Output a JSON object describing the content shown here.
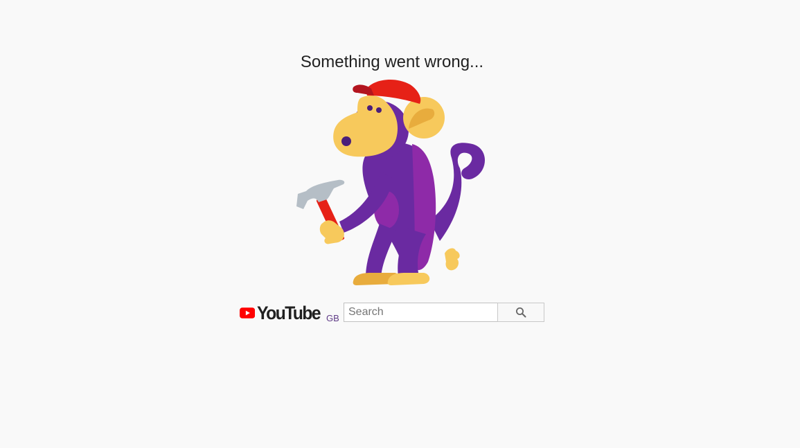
{
  "error": {
    "title": "Something went wrong..."
  },
  "illustration": {
    "name": "monkey-with-hammer"
  },
  "brand": {
    "logo_text": "YouTube",
    "region": "GB",
    "logo_color": "#ff0000"
  },
  "search": {
    "placeholder": "Search",
    "value": "",
    "button_icon": "search-icon"
  },
  "colors": {
    "background": "#f9f9f9",
    "monkey_purple": "#6a2aa1",
    "monkey_face": "#f7c95c",
    "cap_red": "#e62117",
    "hammer_grey": "#b5bec6"
  }
}
